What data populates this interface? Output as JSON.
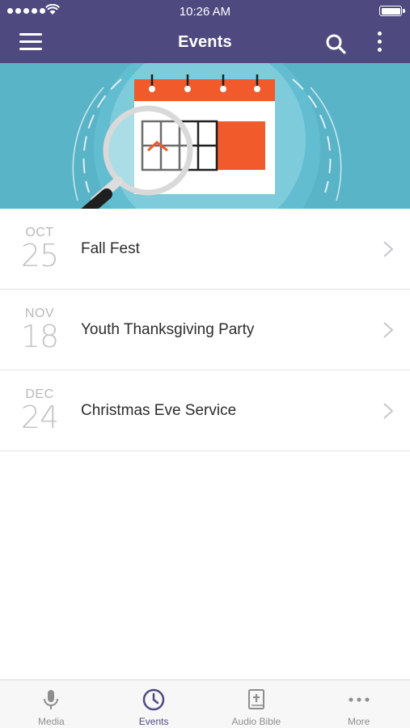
{
  "status_bar": {
    "time": "10:26 AM"
  },
  "header": {
    "title": "Events"
  },
  "events": [
    {
      "month": "OCT",
      "day": "25",
      "title": "Fall Fest"
    },
    {
      "month": "NOV",
      "day": "18",
      "title": "Youth Thanksgiving Party"
    },
    {
      "month": "DEC",
      "day": "24",
      "title": "Christmas Eve Service"
    }
  ],
  "tabs": [
    {
      "label": "Media",
      "icon": "microphone-icon",
      "active": false
    },
    {
      "label": "Events",
      "icon": "clock-icon",
      "active": true
    },
    {
      "label": "Audio Bible",
      "icon": "bible-icon",
      "active": false
    },
    {
      "label": "More",
      "icon": "more-dots-icon",
      "active": false
    }
  ],
  "colors": {
    "nav_background": "#4e4a80",
    "banner_background": "#5ab4c8",
    "calendar_accent": "#f15a2b",
    "active_tab": "#4e4a80",
    "inactive_tab": "#8e8e8e"
  }
}
